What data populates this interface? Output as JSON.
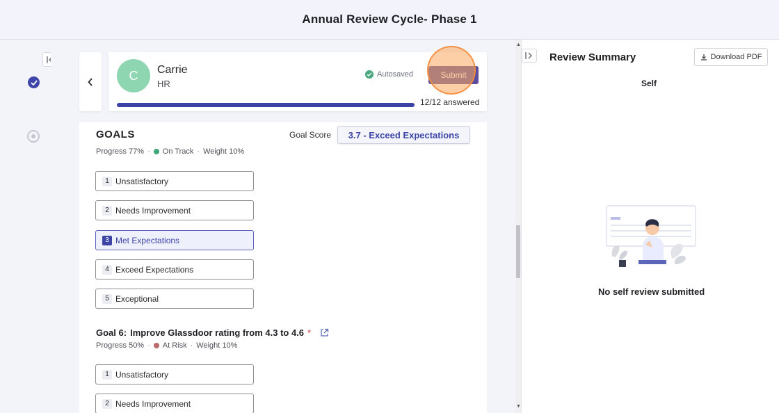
{
  "header": {
    "title": "Annual Review Cycle- Phase 1"
  },
  "employee": {
    "initial": "C",
    "name": "Carrie",
    "department": "HR"
  },
  "status": {
    "autosaved": "Autosaved",
    "submit_label": "Submit",
    "answered": "12/12 answered",
    "progress_fraction": 1.0
  },
  "goals_section": {
    "title": "GOALS",
    "score_label": "Goal Score",
    "score_value": "3.7 - Exceed Expectations",
    "goal5": {
      "progress": "Progress 77%",
      "status": "On Track",
      "weight": "Weight 10%",
      "status_color": "#3fa77a"
    },
    "goal6": {
      "label": "Goal 6:",
      "title": "Improve Glassdoor rating from 4.3 to 4.6",
      "required": "*",
      "progress": "Progress 50%",
      "status": "At Risk",
      "weight": "Weight 10%",
      "status_color": "#b76c6c"
    }
  },
  "rating_options": [
    {
      "num": "1",
      "label": "Unsatisfactory"
    },
    {
      "num": "2",
      "label": "Needs Improvement"
    },
    {
      "num": "3",
      "label": "Met Expectations"
    },
    {
      "num": "4",
      "label": "Exceed Expectations"
    },
    {
      "num": "5",
      "label": "Exceptional"
    }
  ],
  "goal5_selected": "3",
  "review_summary": {
    "title": "Review Summary",
    "download_label": "Download PDF",
    "tab_self": "Self",
    "empty_message": "No self review submitted"
  },
  "colors": {
    "accent": "#3c43a6",
    "submit": "#5b4e9c",
    "avatar": "#8ed6b1"
  }
}
